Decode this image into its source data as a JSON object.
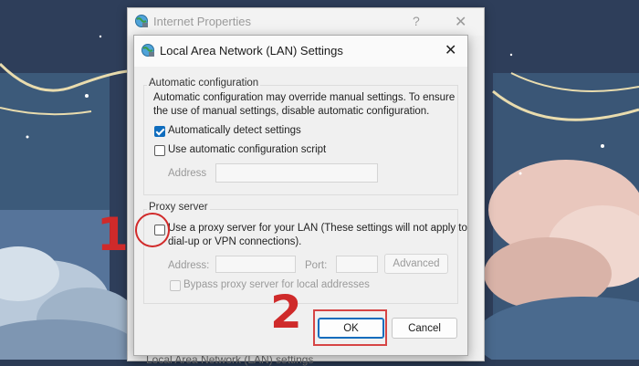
{
  "colors": {
    "annotation_red": "#cf2a2a",
    "accent_blue": "#0f6cbd"
  },
  "outer_window": {
    "title": "Internet Properties",
    "help_glyph": "?",
    "close_glyph": "✕",
    "bottom_text": "Local Area Network (LAN) settings",
    "icon": "globe-network-icon"
  },
  "dialog": {
    "title": "Local Area Network (LAN) Settings",
    "close_glyph": "✕",
    "icon": "globe-network-icon",
    "auto_config": {
      "group_label": "Automatic configuration",
      "description_line1": "Automatic configuration may override manual settings.  To ensure",
      "description_line2": "the use of manual settings, disable automatic configuration.",
      "detect_settings": {
        "label": "Automatically detect settings",
        "checked": true
      },
      "use_script": {
        "label": "Use automatic configuration script",
        "checked": false
      },
      "address_label": "Address",
      "address_value": ""
    },
    "proxy": {
      "group_label": "Proxy server",
      "use_proxy": {
        "label_line1": "Use a proxy server for your LAN (These settings will not apply to",
        "label_line2": "dial-up or VPN connections).",
        "checked": false
      },
      "address_label": "Address:",
      "address_value": "",
      "port_label": "Port:",
      "port_value": "",
      "advanced_label": "Advanced",
      "bypass": {
        "label": "Bypass proxy server for local addresses",
        "checked": false
      }
    },
    "buttons": {
      "ok_label": "OK",
      "cancel_label": "Cancel"
    }
  },
  "annotations": {
    "step1": "1",
    "step2": "2"
  }
}
